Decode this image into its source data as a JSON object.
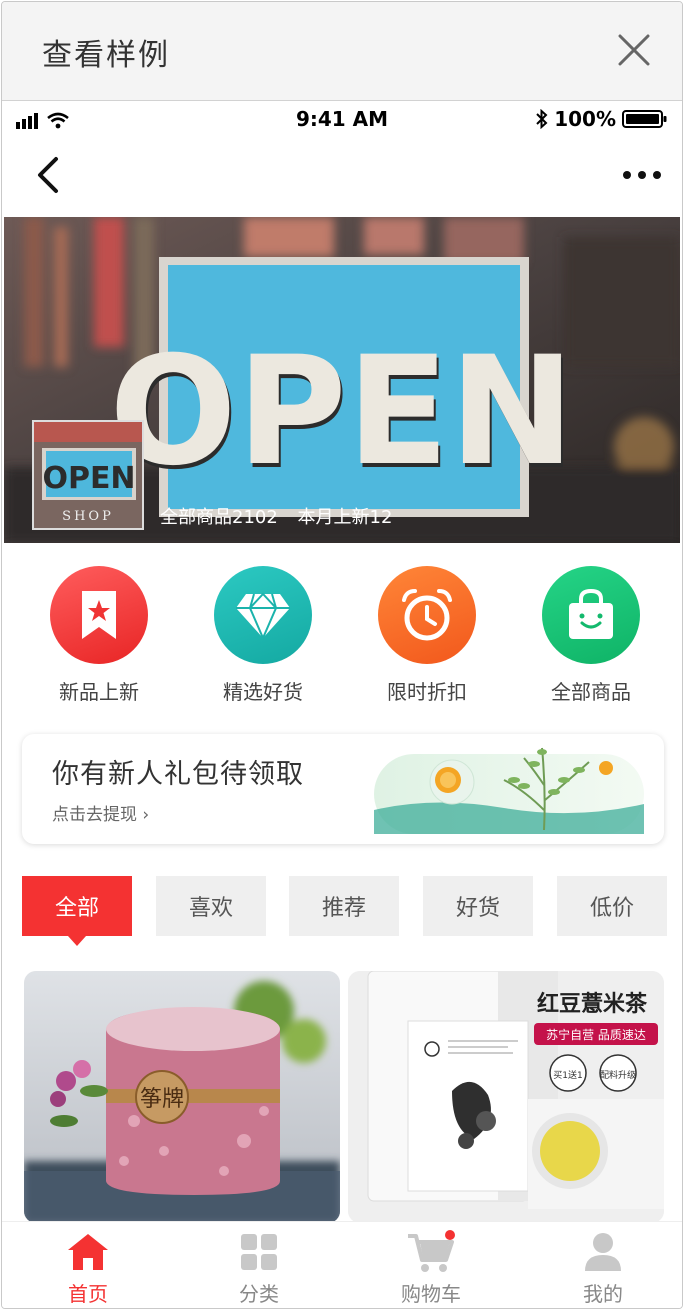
{
  "sample_header": {
    "title": "查看样例"
  },
  "status_bar": {
    "time": "9:41 AM",
    "battery": "100%"
  },
  "banner": {
    "sign_text": "OPEN",
    "logo_text": "OPEN",
    "logo_sub": "SHOP",
    "total_label": "全部商品2102",
    "new_label": "本月上新12"
  },
  "categories": [
    {
      "label": "新品上新",
      "icon": "star-bookmark-icon",
      "color": "#f33a3a"
    },
    {
      "label": "精选好货",
      "icon": "diamond-icon",
      "color": "#1bb9b2"
    },
    {
      "label": "限时折扣",
      "icon": "alarm-clock-icon",
      "color": "#f66f2a"
    },
    {
      "label": "全部商品",
      "icon": "shopping-bag-icon",
      "color": "#18c37a"
    }
  ],
  "promo": {
    "title": "你有新人礼包待领取",
    "link": "点击去提现 ›"
  },
  "tabs": [
    "全部",
    "喜欢",
    "推荐",
    "好货",
    "低价"
  ],
  "products": [
    {
      "image_text": "筝牌"
    },
    {
      "title": "红豆薏米茶",
      "subtitle": "苏宁自营 品质速达",
      "badge1": "买1送1",
      "badge2": "配料升级"
    }
  ],
  "tabbar": [
    {
      "label": "首页",
      "icon": "home-icon"
    },
    {
      "label": "分类",
      "icon": "category-grid-icon"
    },
    {
      "label": "购物车",
      "icon": "cart-icon"
    },
    {
      "label": "我的",
      "icon": "user-icon"
    }
  ],
  "colors": {
    "accent": "#f43232"
  }
}
